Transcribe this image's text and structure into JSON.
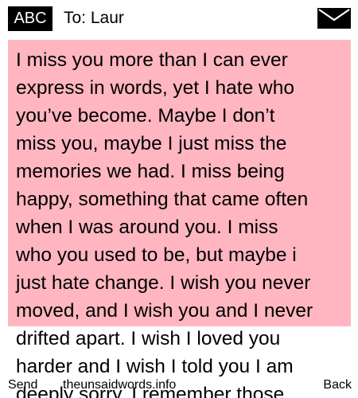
{
  "header": {
    "mode_badge": "ABC",
    "recipient": "To: Laur",
    "message_icon": "envelope-icon"
  },
  "message": {
    "text": "I miss you more than I can ever\nexpress in words, yet I hate who\nyou’ve become. Maybe I don’t\nmiss you, maybe I just miss the\nmemories we had. I miss being\nhappy, something that came often\nwhen I was around you. I miss\nwho you used to be, but maybe i\njust hate change. I wish you never\nmoved, and I wish you and I never\ndrifted apart. I wish I loved you\nharder and I wish I told you I am\ndeeply sorry. I remember those",
    "highlight_color": "#ffb6c1"
  },
  "footer": {
    "send_label": "Send",
    "site_label": "theunsaidwords.info",
    "back_label": "Back"
  }
}
